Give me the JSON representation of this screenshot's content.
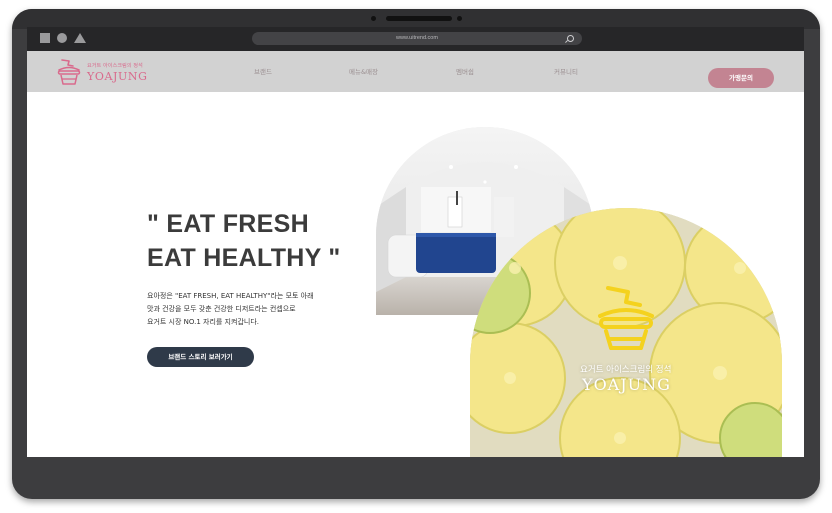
{
  "browser": {
    "url": "www.uitrend.com"
  },
  "header": {
    "logo_tagline": "요거트 아이스크림의 정석",
    "logo_name": "YOAJUNG",
    "nav": [
      "브랜드",
      "메뉴&매장",
      "멤버쉽",
      "커뮤니티"
    ],
    "cta_label": "가맹문의"
  },
  "hero": {
    "title_line1": "\" EAT FRESH",
    "title_line2": "EAT HEALTHY \"",
    "desc_line1": "요아정은 \"EAT FRESH, EAT HEALTHY\"라는 모토 아래",
    "desc_line2": "맛과 건강을 모두 갖춘 건강한 디저트라는 컨셉으로",
    "desc_line3": "요거트 시장 NO.1 자리를 지켜갑니다.",
    "button_label": "브랜드 스토리 보러가기"
  },
  "promo": {
    "tagline": "요거트 아이스크림의 정석",
    "brand": "YOAJUNG"
  },
  "colors": {
    "accent": "#d96a8c",
    "cta": "#c38492",
    "button_dark": "#2f3a49",
    "header_bg": "#d2d2d2",
    "device": "#3d3d3f"
  },
  "icons": [
    "square-icon",
    "circle-icon",
    "triangle-icon",
    "search-icon",
    "yogurt-cup-icon"
  ]
}
